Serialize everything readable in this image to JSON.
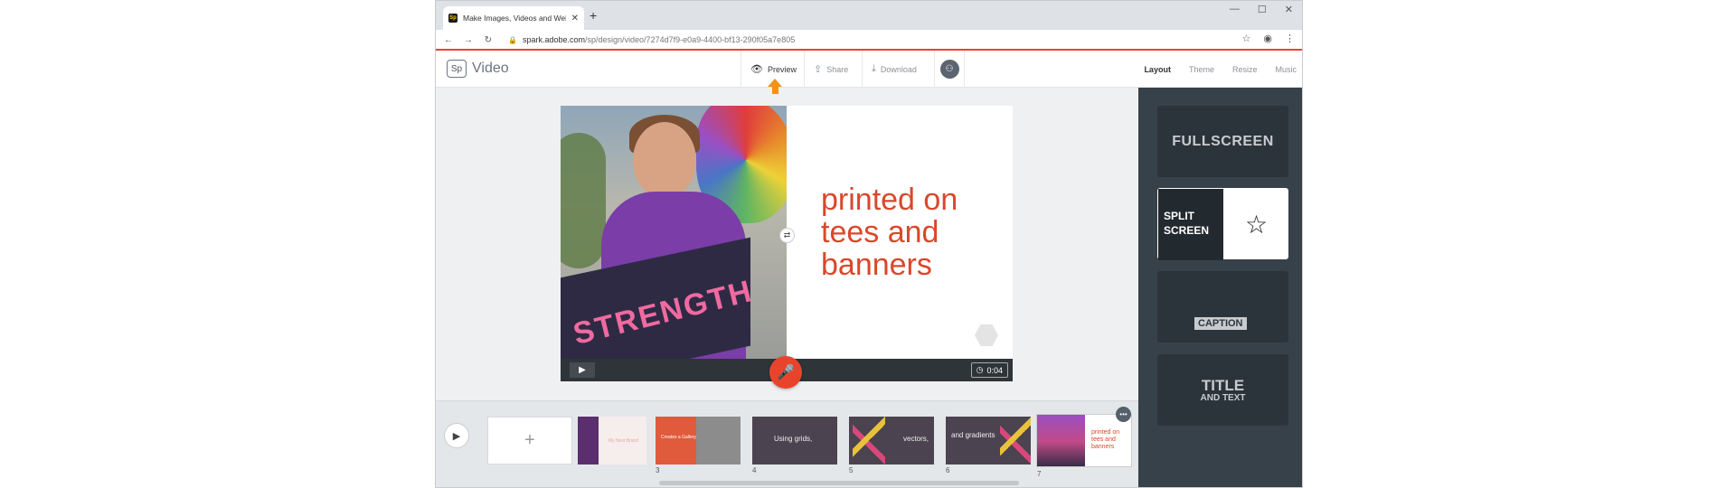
{
  "browser": {
    "tab_title": "Make Images, Videos and Web S",
    "tab_close": "✕",
    "new_tab": "+",
    "window_controls": [
      "—",
      "☐",
      "✕"
    ],
    "url_host": "spark.adobe.com",
    "url_path": "/sp/design/video/7274d7f9-e0a9-4400-bf13-290f05a7e805"
  },
  "app": {
    "logo_mark": "Sp",
    "logo_text": "Video",
    "header_buttons": {
      "preview": "Preview",
      "share": "Share",
      "download": "Download"
    },
    "right_tabs": [
      "Layout",
      "Theme",
      "Resize",
      "Music"
    ],
    "active_tab": "Layout",
    "accent_color": "#e8442c",
    "arrow_color": "#f39215"
  },
  "slide": {
    "text": "printed on tees and banners",
    "sign_text": "STRENGTH",
    "time": "0:04"
  },
  "filmstrip": {
    "add_label": "+",
    "thumbs": [
      {
        "num": "",
        "label": "My Next Brand"
      },
      {
        "num": "3",
        "label": "Creates a Gallery"
      },
      {
        "num": "4",
        "label": "Using grids,"
      },
      {
        "num": "5",
        "label": "vectors,"
      },
      {
        "num": "6",
        "label": "and gradients"
      },
      {
        "num": "7",
        "label": "printed on tees and banners"
      }
    ],
    "more_label": "•••"
  },
  "layouts": {
    "fullscreen": "FULLSCREEN",
    "split_screen": "SPLIT SCREEN",
    "caption": "CAPTION",
    "title": "TITLE",
    "title_sub": "AND TEXT"
  }
}
